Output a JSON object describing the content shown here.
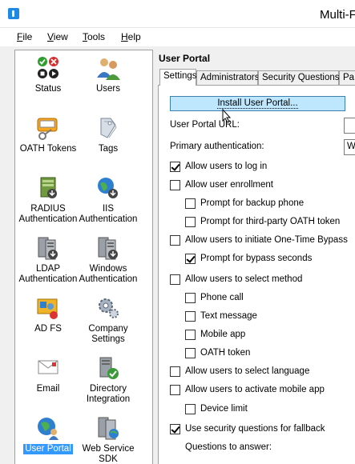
{
  "window": {
    "title": "Multi-F"
  },
  "menu": {
    "file": {
      "u": "F",
      "rest": "ile"
    },
    "view": {
      "u": "V",
      "rest": "iew"
    },
    "tools": {
      "u": "T",
      "rest": "ools"
    },
    "help": {
      "u": "H",
      "rest": "elp"
    }
  },
  "nav": [
    {
      "label": "Status",
      "icon": "status-icon"
    },
    {
      "label": "Users",
      "icon": "users-icon"
    },
    {
      "label": "OATH Tokens",
      "icon": "oath-tokens-icon"
    },
    {
      "label": "Tags",
      "icon": "tags-icon"
    },
    {
      "label": "RADIUS Authentication",
      "icon": "radius-server-icon"
    },
    {
      "label": "IIS Authentication",
      "icon": "iis-globe-icon"
    },
    {
      "label": "LDAP Authentication",
      "icon": "ldap-server-icon"
    },
    {
      "label": "Windows Authentication",
      "icon": "windows-server-icon"
    },
    {
      "label": "AD FS",
      "icon": "adfs-icon"
    },
    {
      "label": "Company Settings",
      "icon": "company-settings-icon"
    },
    {
      "label": "Email",
      "icon": "email-icon"
    },
    {
      "label": "Directory Integration",
      "icon": "directory-integration-icon"
    },
    {
      "label": "User Portal",
      "icon": "user-portal-icon",
      "selected": true
    },
    {
      "label": "Web Service SDK",
      "icon": "web-service-sdk-icon"
    }
  ],
  "section_title": "User Portal",
  "tabs": [
    "Settings",
    "Administrators",
    "Security Questions",
    "Pa"
  ],
  "active_tab": "Settings",
  "install_button": "Install User Portal...",
  "fields": {
    "portal_url_label": "User Portal URL:",
    "primary_auth_label": "Primary authentication:",
    "primary_auth_value": "W"
  },
  "checkboxes": [
    {
      "label": "Allow users to log in",
      "checked": true
    },
    {
      "label": "Allow user enrollment",
      "checked": false
    },
    {
      "label": "Prompt for backup phone",
      "checked": false
    },
    {
      "label": "Prompt for third-party OATH token",
      "checked": false
    },
    {
      "label": "Allow users to initiate One-Time Bypass",
      "checked": false
    },
    {
      "label": "Prompt for bypass seconds",
      "checked": true
    },
    {
      "label": "Allow users to select method",
      "checked": false
    },
    {
      "label": "Phone call",
      "checked": false
    },
    {
      "label": "Text message",
      "checked": false
    },
    {
      "label": "Mobile app",
      "checked": false
    },
    {
      "label": "OATH token",
      "checked": false
    },
    {
      "label": "Allow users to select language",
      "checked": false
    },
    {
      "label": "Allow users to activate mobile app",
      "checked": false
    },
    {
      "label": "Device limit",
      "checked": false
    },
    {
      "label": "Use security questions for fallback",
      "checked": true
    }
  ],
  "questions_label": "Questions to answer:"
}
